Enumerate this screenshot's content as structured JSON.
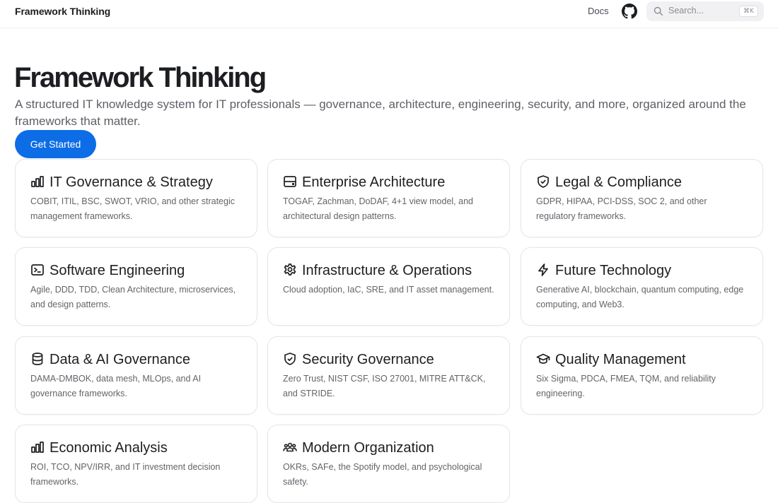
{
  "nav": {
    "brand": "Framework Thinking",
    "docs_label": "Docs",
    "search_placeholder": "Search...",
    "search_shortcut": "⌘K"
  },
  "hero": {
    "title": "Framework Thinking",
    "subtitle": "A structured IT knowledge system for IT professionals — governance, architecture, engineering, security, and more, organized around the frameworks that matter.",
    "cta_label": "Get Started"
  },
  "colors": {
    "accent": "#0d6de6",
    "text": "#1c1e21",
    "muted": "#626469"
  },
  "cards": [
    {
      "icon": "bar-chart-icon",
      "title": "IT Governance & Strategy",
      "description": "COBIT, ITIL, BSC, SWOT, VRIO, and other strategic management frameworks."
    },
    {
      "icon": "server-icon",
      "title": "Enterprise Architecture",
      "description": "TOGAF, Zachman, DoDAF, 4+1 view model, and architectural design patterns."
    },
    {
      "icon": "shield-check-icon",
      "title": "Legal & Compliance",
      "description": "GDPR, HIPAA, PCI-DSS, SOC 2, and other regulatory frameworks."
    },
    {
      "icon": "terminal-icon",
      "title": "Software Engineering",
      "description": "Agile, DDD, TDD, Clean Architecture, microservices, and design patterns."
    },
    {
      "icon": "gear-icon",
      "title": "Infrastructure & Operations",
      "description": "Cloud adoption, IaC, SRE, and IT asset management."
    },
    {
      "icon": "lightning-icon",
      "title": "Future Technology",
      "description": "Generative AI, blockchain, quantum computing, edge computing, and Web3."
    },
    {
      "icon": "database-icon",
      "title": "Data & AI Governance",
      "description": "DAMA-DMBOK, data mesh, MLOps, and AI governance frameworks."
    },
    {
      "icon": "shield-check-icon",
      "title": "Security Governance",
      "description": "Zero Trust, NIST CSF, ISO 27001, MITRE ATT&CK, and STRIDE."
    },
    {
      "icon": "graduation-cap-icon",
      "title": "Quality Management",
      "description": "Six Sigma, PDCA, FMEA, TQM, and reliability engineering."
    },
    {
      "icon": "bar-chart-icon",
      "title": "Economic Analysis",
      "description": "ROI, TCO, NPV/IRR, and IT investment decision frameworks."
    },
    {
      "icon": "people-icon",
      "title": "Modern Organization",
      "description": "OKRs, SAFe, the Spotify model, and psychological safety."
    }
  ]
}
